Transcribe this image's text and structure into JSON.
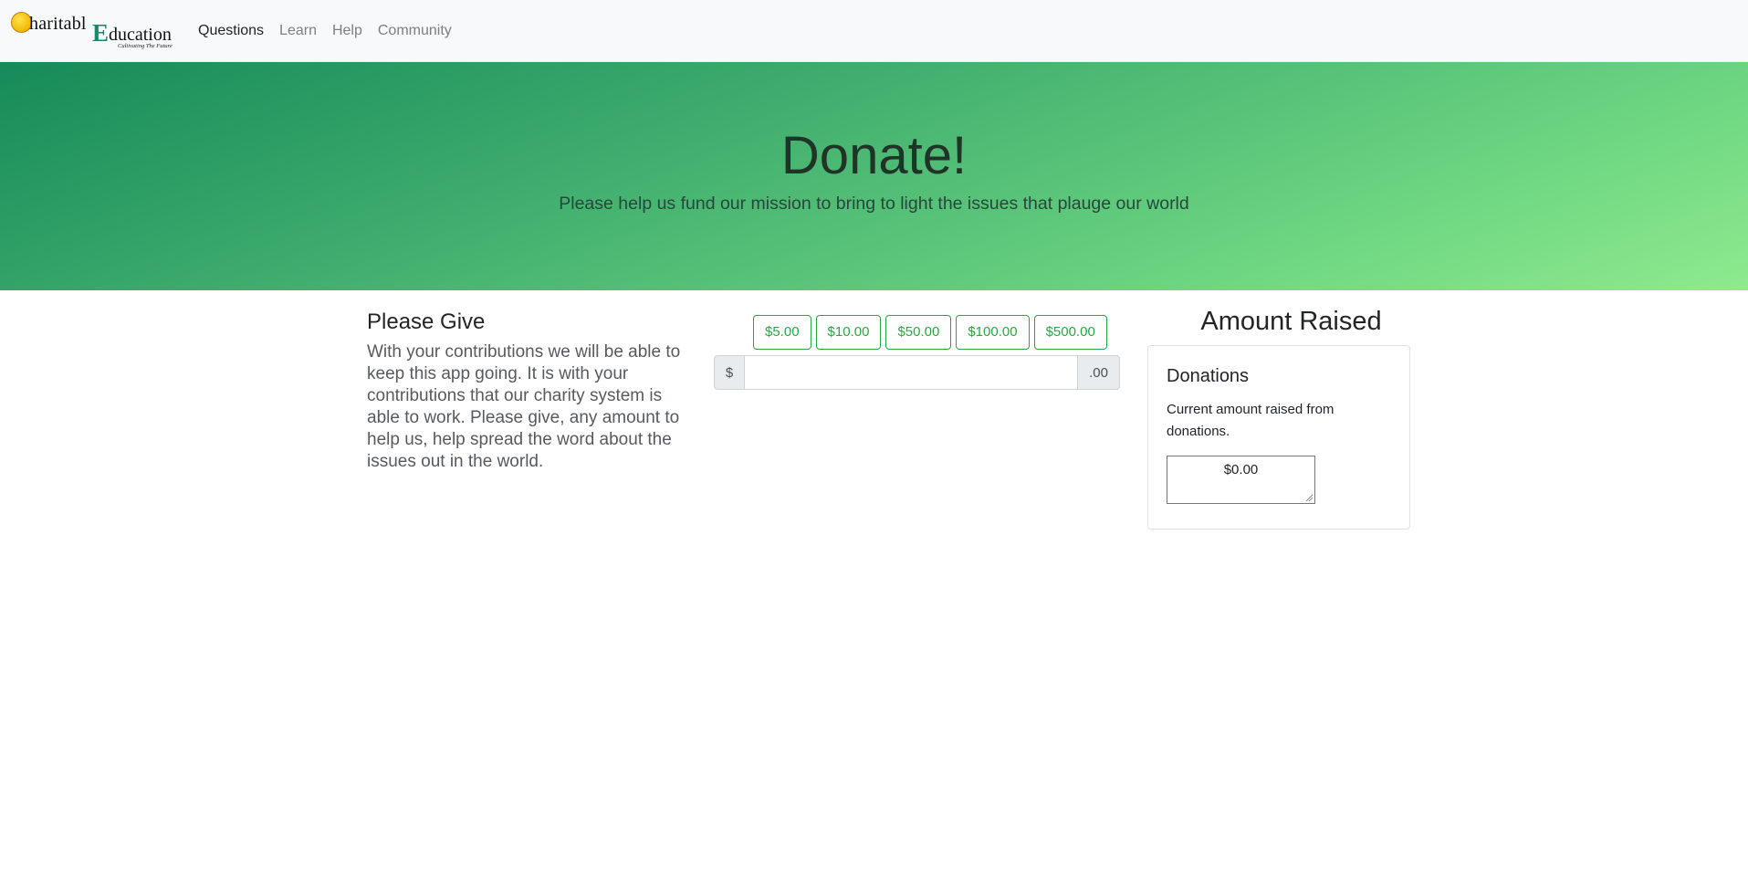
{
  "brand": {
    "first_word": "haritabl",
    "second_initial": "E",
    "second_word": "ducation",
    "tagline": "Cultivating The Future"
  },
  "nav": {
    "items": [
      {
        "label": "Questions",
        "active": true
      },
      {
        "label": "Learn",
        "active": false
      },
      {
        "label": "Help",
        "active": false
      },
      {
        "label": "Community",
        "active": false
      }
    ]
  },
  "hero": {
    "title": "Donate!",
    "subtitle": "Please help us fund our mission to bring to light the issues that plauge our world",
    "gradient_start": "#168a59",
    "gradient_end": "#8eea8e"
  },
  "give": {
    "title": "Please Give",
    "text": "With your contributions we will be able to keep this app going. It is with your contributions that our charity system is able to work. Please give, any amount to help us, help spread the word about the issues out in the world."
  },
  "amounts": {
    "buttons": [
      "$5.00",
      "$10.00",
      "$50.00",
      "$100.00",
      "$500.00"
    ],
    "prefix": "$",
    "suffix": ".00",
    "input_value": ""
  },
  "raised": {
    "title": "Amount Raised",
    "card_title": "Donations",
    "card_text": "Current amount raised from donations.",
    "total": "$0.00"
  },
  "colors": {
    "accent": "#28a745",
    "navbar_bg": "#f8f9fa"
  }
}
